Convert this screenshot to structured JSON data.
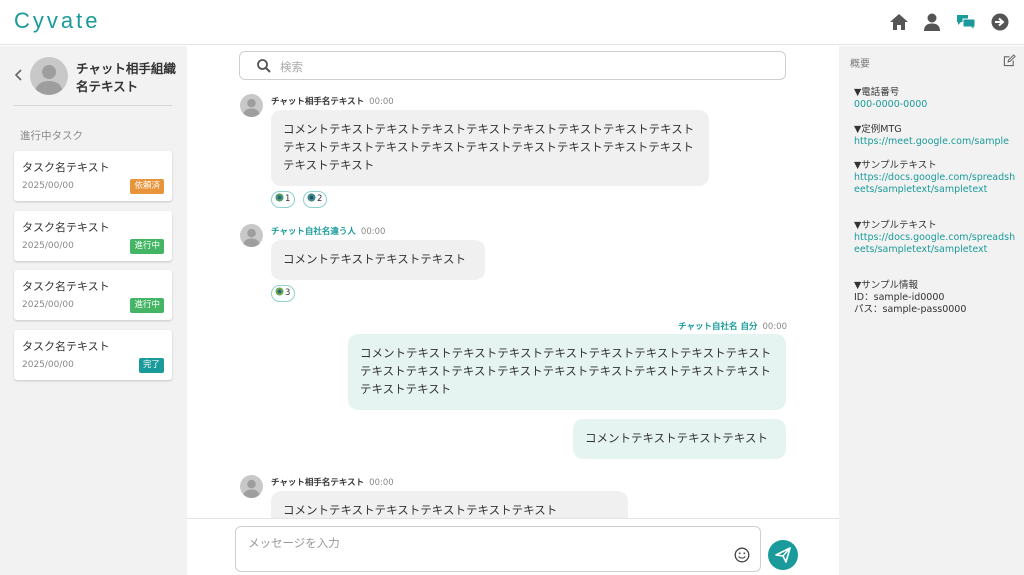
{
  "header": {
    "logo": "Cyvate",
    "icons": [
      "home-icon",
      "user-icon",
      "chat-icon",
      "logout-icon"
    ]
  },
  "sidebar": {
    "partner_name": "チャット相手組織名テキスト",
    "section_title": "進行中タスク",
    "tasks": [
      {
        "name": "タスク名テキスト",
        "date": "2025/00/00",
        "status": "依頼済",
        "color": "#e8943a"
      },
      {
        "name": "タスク名テキスト",
        "date": "2025/00/00",
        "status": "進行中",
        "color": "#43b564"
      },
      {
        "name": "タスク名テキスト",
        "date": "2025/00/00",
        "status": "進行中",
        "color": "#43b564"
      },
      {
        "name": "タスク名テキスト",
        "date": "2025/00/00",
        "status": "完了",
        "color": "#1a9a9a"
      }
    ]
  },
  "search": {
    "placeholder": "検索"
  },
  "messages": [
    {
      "sender": "チャット相手名テキスト",
      "time": "00:00",
      "text": "コメントテキストテキストテキストテキストテキストテキストテキストテキストテキストテキストテキストテキストテキストテキストテキストテキストテキストテキストテキスト",
      "reactions": [
        {
          "count": "1"
        },
        {
          "count": "2"
        }
      ]
    },
    {
      "sender": "チャット自社名違う人",
      "time": "00:00",
      "text": "コメントテキストテキストテキスト",
      "reactions": [
        {
          "count": "3"
        }
      ]
    },
    {
      "sender": "チャット自社名 自分",
      "time": "00:00",
      "text": "コメントテキストテキストテキストテキストテキストテキストテキストテキストテキストテキストテキストテキストテキストテキストテキストテキストテキストテキストテキスト"
    },
    {
      "text": "コメントテキストテキストテキスト"
    },
    {
      "sender": "チャット相手名テキスト",
      "time": "00:00",
      "text": "コメントテキストテキストテキストテキストテキスト"
    }
  ],
  "composer": {
    "placeholder": "メッセージを入力"
  },
  "overview": {
    "title": "概要",
    "items": [
      {
        "label": "▼電話番号",
        "value": "000-0000-0000"
      },
      {
        "label": "▼定例MTG",
        "value": "https://meet.google.com/sample"
      },
      {
        "label": "▼サンプルテキスト",
        "value": "https://docs.google.com/spreadsheets/sampletext/sampletext"
      },
      {
        "label": "▼サンプルテキスト",
        "value": "https://docs.google.com/spreadsheets/sampletext/sampletext"
      },
      {
        "label": "▼サンプル情報",
        "line1": "ID：sample-id0000",
        "line2": "パス：sample-pass0000"
      }
    ]
  },
  "colors": {
    "accent": "#1a9a9a",
    "panel": "#f2f2f2",
    "bubble_in": "#f0f0f0",
    "bubble_out": "#e6f4f1"
  }
}
